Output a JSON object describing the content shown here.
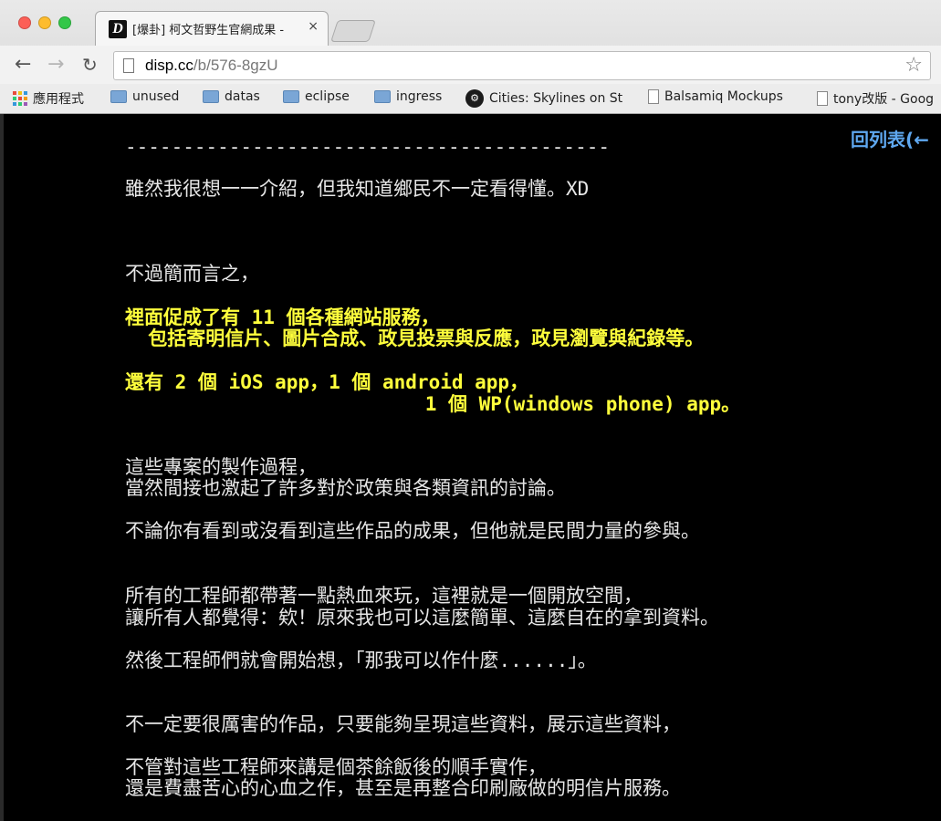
{
  "browser": {
    "tab_favicon": "D",
    "tab_title": "[爆卦] 柯文哲野生官網成果 -",
    "tab_close": "×",
    "url_host": "disp.cc",
    "url_path": "/b/576-8gzU",
    "bookmarks": [
      {
        "icon": "apps-icon",
        "label": "應用程式"
      },
      {
        "icon": "folder-icon",
        "label": "unused"
      },
      {
        "icon": "folder-icon",
        "label": "datas"
      },
      {
        "icon": "folder-icon",
        "label": "eclipse"
      },
      {
        "icon": "folder-icon",
        "label": "ingress"
      },
      {
        "icon": "steam-icon",
        "label": "Cities: Skylines on St"
      },
      {
        "icon": "page-icon",
        "label": "Balsamiq Mockups"
      },
      {
        "icon": "page-icon",
        "label": "tony改版 - Goog"
      }
    ]
  },
  "page": {
    "back_link": "回列表(←",
    "lines": [
      {
        "text": "------------------------------------------",
        "color": "white"
      },
      {
        "text": "雖然我很想一一介紹，但我知道鄉民不一定看得懂。XD",
        "color": "white"
      },
      {
        "text": "不過簡而言之，",
        "color": "white"
      },
      {
        "text": "裡面促成了有 11 個各種網站服務，",
        "color": "yellow"
      },
      {
        "text": "  包括寄明信片、圖片合成、政見投票與反應，政見瀏覽與紀錄等。",
        "color": "yellow"
      },
      {
        "text": "還有 2 個 iOS app，1 個 android app，",
        "color": "yellow"
      },
      {
        "text": "                          1 個 WP(windows phone) app。",
        "color": "yellow"
      },
      {
        "text": "這些專案的製作過程，",
        "color": "white"
      },
      {
        "text": "當然間接也激起了許多對於政策與各類資訊的討論。",
        "color": "white"
      },
      {
        "text": "不論你有看到或沒看到這些作品的成果，但他就是民間力量的參與。",
        "color": "white"
      },
      {
        "text": "所有的工程師都帶著一點熱血來玩，這裡就是一個開放空間，",
        "color": "white"
      },
      {
        "text": "讓所有人都覺得：欸！原來我也可以這麼簡單、這麼自在的拿到資料。",
        "color": "white"
      },
      {
        "text": "然後工程師們就會開始想，「那我可以作什麼......」。",
        "color": "white"
      },
      {
        "text": "不一定要很厲害的作品，只要能夠呈現這些資料，展示這些資料，",
        "color": "white"
      },
      {
        "text": "不管對這些工程師來講是個茶餘飯後的順手實作，",
        "color": "white"
      },
      {
        "text": "還是費盡苦心的心血之作，甚至是再整合印刷廠做的明信片服務。",
        "color": "white"
      }
    ]
  },
  "colors": {
    "text_white": "#e6e6e6",
    "text_yellow": "#ffff3c",
    "link_blue": "#5fa8f0",
    "background": "#000000"
  }
}
